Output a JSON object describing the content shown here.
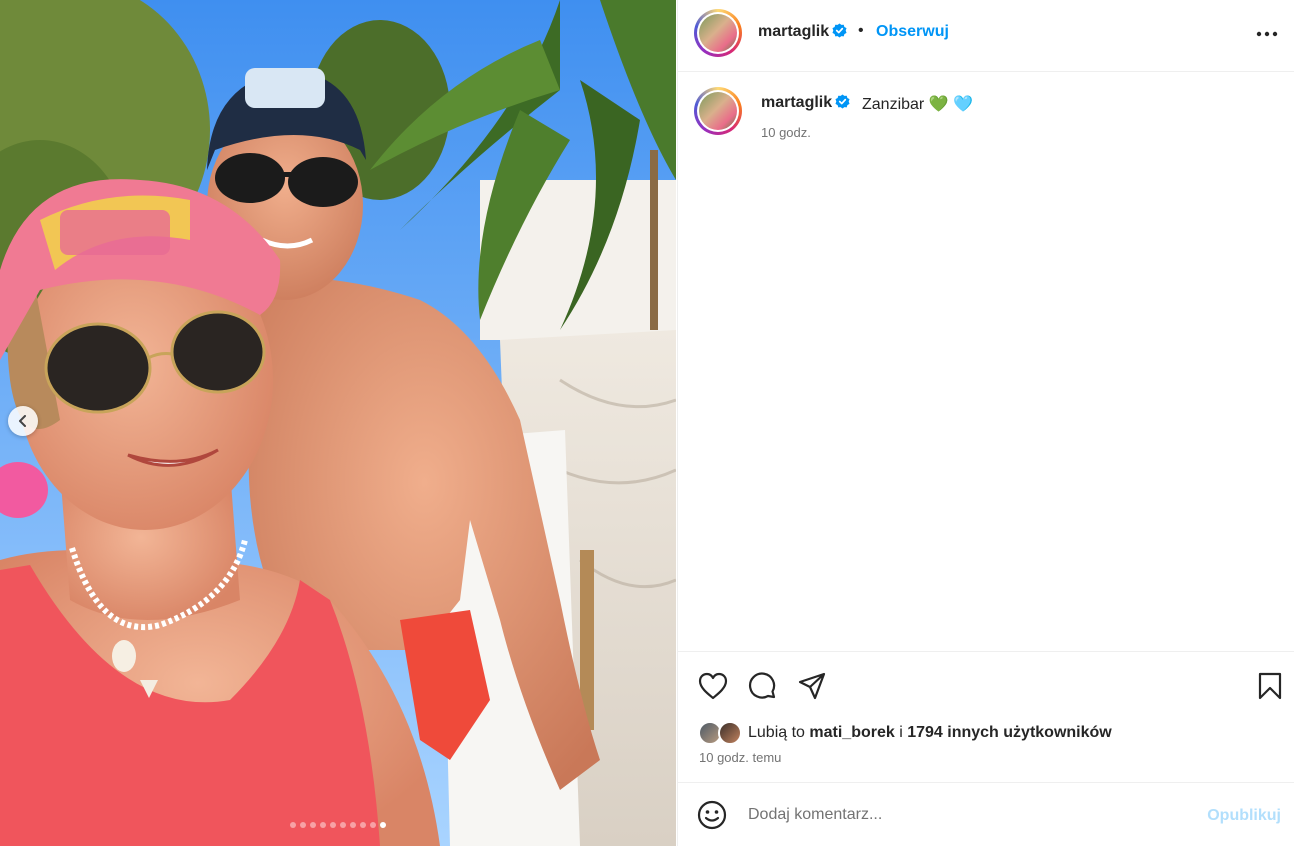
{
  "post": {
    "username": "martaglik",
    "follow_label": "Obserwuj",
    "separator": "•",
    "caption_text": "Zanzibar 💚 🩵",
    "caption_time": "10 godz.",
    "likes_prefix": "Lubią to ",
    "likes_user": "mati_borek",
    "likes_middle": " i ",
    "likes_count_text": "1794 innych użytkowników",
    "posted_time": "10 godz. temu",
    "comment_placeholder": "Dodaj komentarz...",
    "publish_label": "Opublikuj"
  },
  "carousel": {
    "slide_count": 10,
    "active_index": 10
  },
  "colors": {
    "link_blue": "#0095f6",
    "publish_disabled": "#b2dffc",
    "secondary_text": "#737373",
    "divider": "#efefef",
    "verified_blue": "#0095f6"
  },
  "icons": [
    "chevron-left-icon",
    "verified-badge-icon",
    "more-options-icon",
    "heart-icon",
    "comment-icon",
    "share-icon",
    "bookmark-icon",
    "emoji-icon"
  ]
}
